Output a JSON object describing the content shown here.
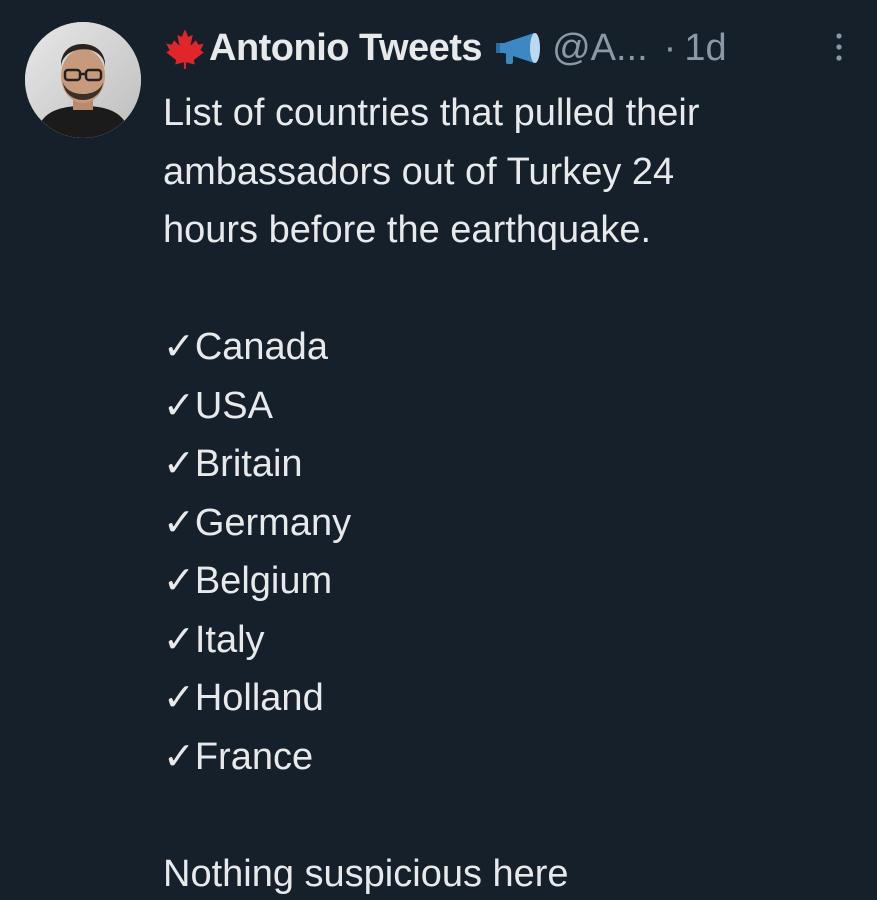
{
  "author": {
    "display_name": "Antonio Tweets",
    "handle": "@A...",
    "separator": "·",
    "timestamp": "1d",
    "avatar_icon": "person-avatar-icon",
    "flag_icon": "maple-leaf-icon",
    "badge_icon": "megaphone-icon"
  },
  "tweet": {
    "intro_lines": [
      "List of countries that pulled their",
      "ambassadors out of Turkey 24",
      "hours before the earthquake."
    ],
    "list_items": [
      "✓Canada",
      "✓USA",
      "✓Britain",
      "✓Germany",
      "✓Belgium",
      "✓Italy",
      "✓Holland",
      "✓France"
    ],
    "closing": "Nothing suspicious here"
  },
  "colors": {
    "background": "#15202b",
    "text": "#e7e9ea",
    "secondary_text": "#8b98a5",
    "flag_red": "#e0262b",
    "megaphone_blue": "#3b88c3"
  }
}
